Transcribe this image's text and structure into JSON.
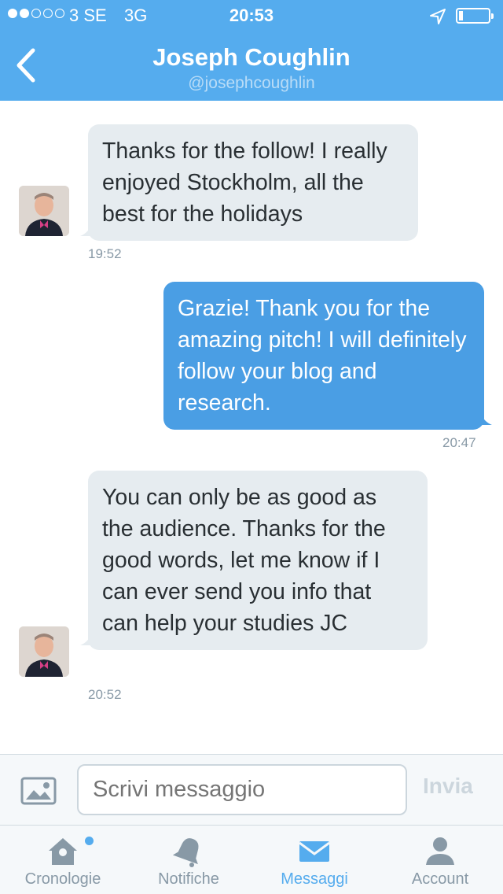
{
  "status_bar": {
    "carrier": "3 SE",
    "network": "3G",
    "time": "20:53",
    "signal_strength": 2,
    "signal_max": 5,
    "battery_level": 0.12
  },
  "header": {
    "title": "Joseph Coughlin",
    "subtitle": "@josephcoughlin",
    "back_icon": "chevron-left-icon"
  },
  "messages": [
    {
      "direction": "incoming",
      "text": "Thanks for the follow! I really enjoyed Stockholm, all the best for the holidays",
      "time": "19:52"
    },
    {
      "direction": "outgoing",
      "text": "Grazie! Thank you for the amazing pitch! I will definitely follow your blog and research.",
      "time": "20:47"
    },
    {
      "direction": "incoming",
      "text": "You can only be as good as the audience. Thanks for the good words, let me know if I can ever send you info that can help your studies JC",
      "time": "20:52"
    }
  ],
  "compose": {
    "placeholder": "Scrivi messaggio",
    "send_label": "Invia",
    "photo_icon": "photo-icon"
  },
  "tabs": [
    {
      "label": "Cronologie",
      "icon": "home-icon",
      "active": false,
      "has_notification": true
    },
    {
      "label": "Notifiche",
      "icon": "bell-icon",
      "active": false
    },
    {
      "label": "Messaggi",
      "icon": "envelope-icon",
      "active": true
    },
    {
      "label": "Account",
      "icon": "person-icon",
      "active": false
    }
  ],
  "colors": {
    "brand": "#55acee",
    "outgoing_bubble": "#4a9ee4",
    "incoming_bubble": "#e6ecf0",
    "muted": "#8899a6"
  }
}
